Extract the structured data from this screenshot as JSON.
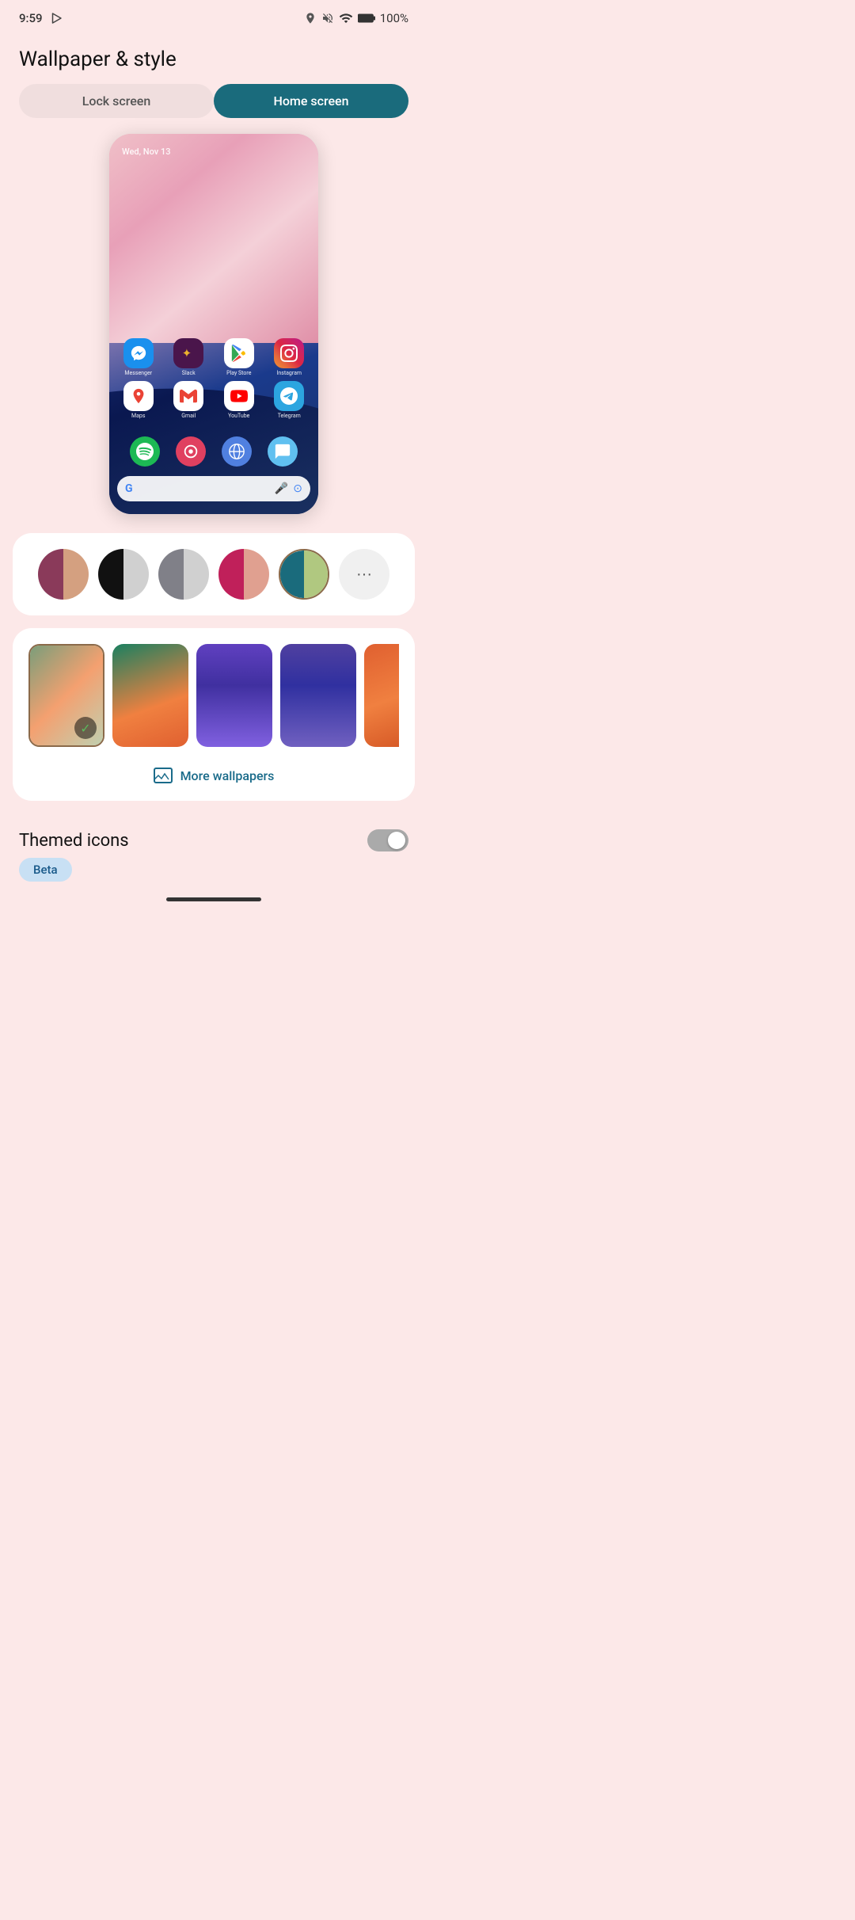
{
  "status": {
    "time": "9:59",
    "battery": "100%"
  },
  "page": {
    "title": "Wallpaper & style"
  },
  "tabs": {
    "lock_screen": "Lock screen",
    "home_screen": "Home screen"
  },
  "phone_preview": {
    "date": "Wed, Nov 13",
    "apps_row1": [
      {
        "label": "Messenger",
        "color": "#0080ff",
        "bg": "#1a90ff"
      },
      {
        "label": "Slack",
        "color": "#611f69",
        "bg": "#fff"
      },
      {
        "label": "Play Store",
        "color": "#00b060",
        "bg": "#fff"
      },
      {
        "label": "Instagram",
        "color": "#e040a0",
        "bg": "#fff"
      }
    ],
    "apps_row2": [
      {
        "label": "Maps",
        "color": "#4285f4",
        "bg": "#fff"
      },
      {
        "label": "Gmail",
        "color": "#ea4335",
        "bg": "#fff"
      },
      {
        "label": "YouTube",
        "color": "#ff0000",
        "bg": "#fff"
      },
      {
        "label": "Telegram",
        "color": "#2ca5e0",
        "bg": "#fff"
      }
    ],
    "dock_apps": [
      "Spotify",
      "Cortana",
      "Browser",
      "Messages"
    ]
  },
  "palette": {
    "swatches": [
      {
        "top": "#8a3a5a",
        "bottom": "#d4a080"
      },
      {
        "top": "#111111",
        "bottom": "#d0d0d0"
      },
      {
        "top": "#808088",
        "bottom": "#d0d0d0"
      },
      {
        "top": "#c0205a",
        "bottom": "#e0a090"
      },
      {
        "top": "#1a6b7c",
        "bottom": "#b0c880"
      },
      {
        "more": true
      }
    ]
  },
  "wallpapers": [
    {
      "selected": true
    },
    {},
    {},
    {},
    {}
  ],
  "more_wallpapers_label": "More wallpapers",
  "themed_icons": {
    "label": "Themed icons",
    "enabled": false,
    "beta_label": "Beta"
  }
}
